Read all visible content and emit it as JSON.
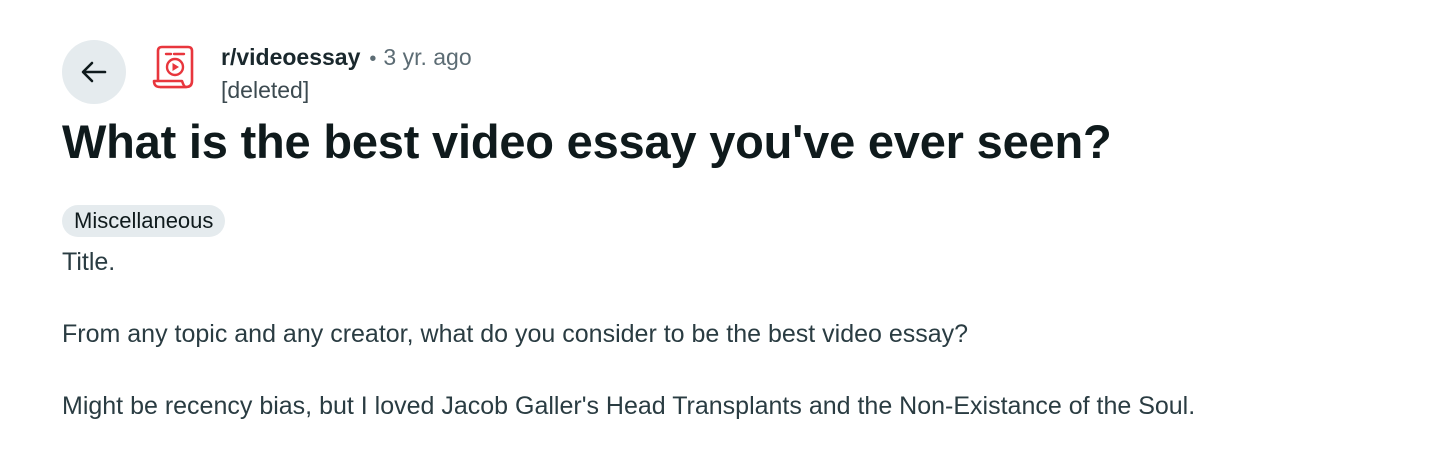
{
  "header": {
    "back_icon": "arrow-left-icon",
    "subreddit_icon": "video-scroll-icon",
    "subreddit": "r/videoessay",
    "separator": "•",
    "age": "3 yr. ago",
    "author": "[deleted]"
  },
  "post": {
    "title": "What is the best video essay you've ever seen?",
    "flair": "Miscellaneous",
    "paragraphs": [
      "Title.",
      "From any topic and any creator, what do you consider to be the best video essay?",
      "Might be recency bias, but I loved Jacob Galler's Head Transplants and the Non-Existance of the Soul."
    ]
  },
  "colors": {
    "accent_icon": "#e8363d",
    "button_bg": "#e5ebee",
    "text_primary": "#0f1a1c",
    "text_secondary": "#5c6c74"
  }
}
